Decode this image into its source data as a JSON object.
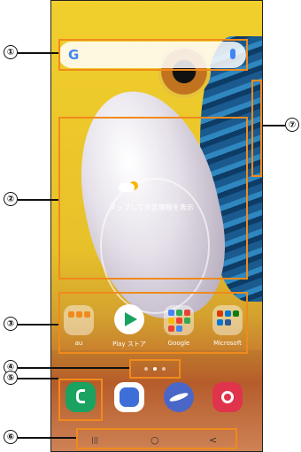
{
  "search": {
    "glyph": "G"
  },
  "weather": {
    "text": "タップして天気情報を表示"
  },
  "apps": {
    "au": "au",
    "play": "Play ストア",
    "google": "Google",
    "microsoft": "Microsoft"
  },
  "callouts": [
    "①",
    "②",
    "③",
    "④",
    "⑤",
    "⑥",
    "⑦"
  ],
  "nav": {
    "recent": "|||",
    "home": "○",
    "back": "<"
  },
  "colors": {
    "highlight": "#f08a1c",
    "phone": "#1aa260",
    "messages": "#3c6fd7",
    "internet": "#4a67c8",
    "camera": "#e0334c"
  }
}
